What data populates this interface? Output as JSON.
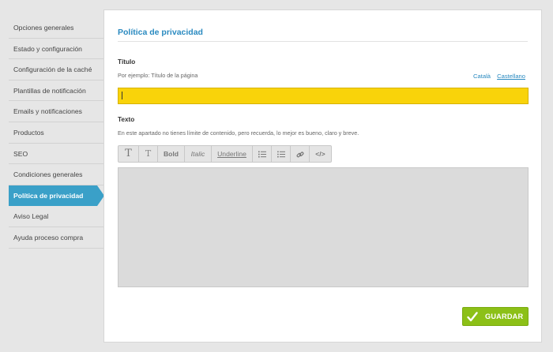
{
  "sidebar": {
    "items": [
      {
        "label": "Opciones generales"
      },
      {
        "label": "Estado y configuración"
      },
      {
        "label": "Configuración de la caché"
      },
      {
        "label": "Plantillas de notificación"
      },
      {
        "label": "Emails y notificaciones"
      },
      {
        "label": "Productos"
      },
      {
        "label": "SEO"
      },
      {
        "label": "Condiciones generales"
      },
      {
        "label": "Política de privacidad"
      },
      {
        "label": "Aviso Legal"
      },
      {
        "label": "Ayuda proceso compra"
      }
    ],
    "active_index": 8,
    "active_color": "#3aa0c8"
  },
  "main": {
    "title": "Política de privacidad",
    "titulo_label": "Título",
    "titulo_hint": "Por ejemplo: Título de la página",
    "languages": [
      "Català",
      "Castellano"
    ],
    "selected_language": "Castellano",
    "titulo_value": "",
    "texto_label": "Texto",
    "texto_hint": "En este apartado no tienes límite de contenido, pero recuerda, lo mejor es bueno, claro y breve.",
    "toolbar": {
      "heading1": "T",
      "heading2": "T",
      "bold": "Bold",
      "italic": "Italic",
      "underline": "Underline",
      "ordered_list_icon": "ordered-list-icon",
      "unordered_list_icon": "unordered-list-icon",
      "link_icon": "link-icon",
      "code": "</>"
    },
    "save_label": "GUARDAR",
    "save_color": "#8cc017"
  }
}
